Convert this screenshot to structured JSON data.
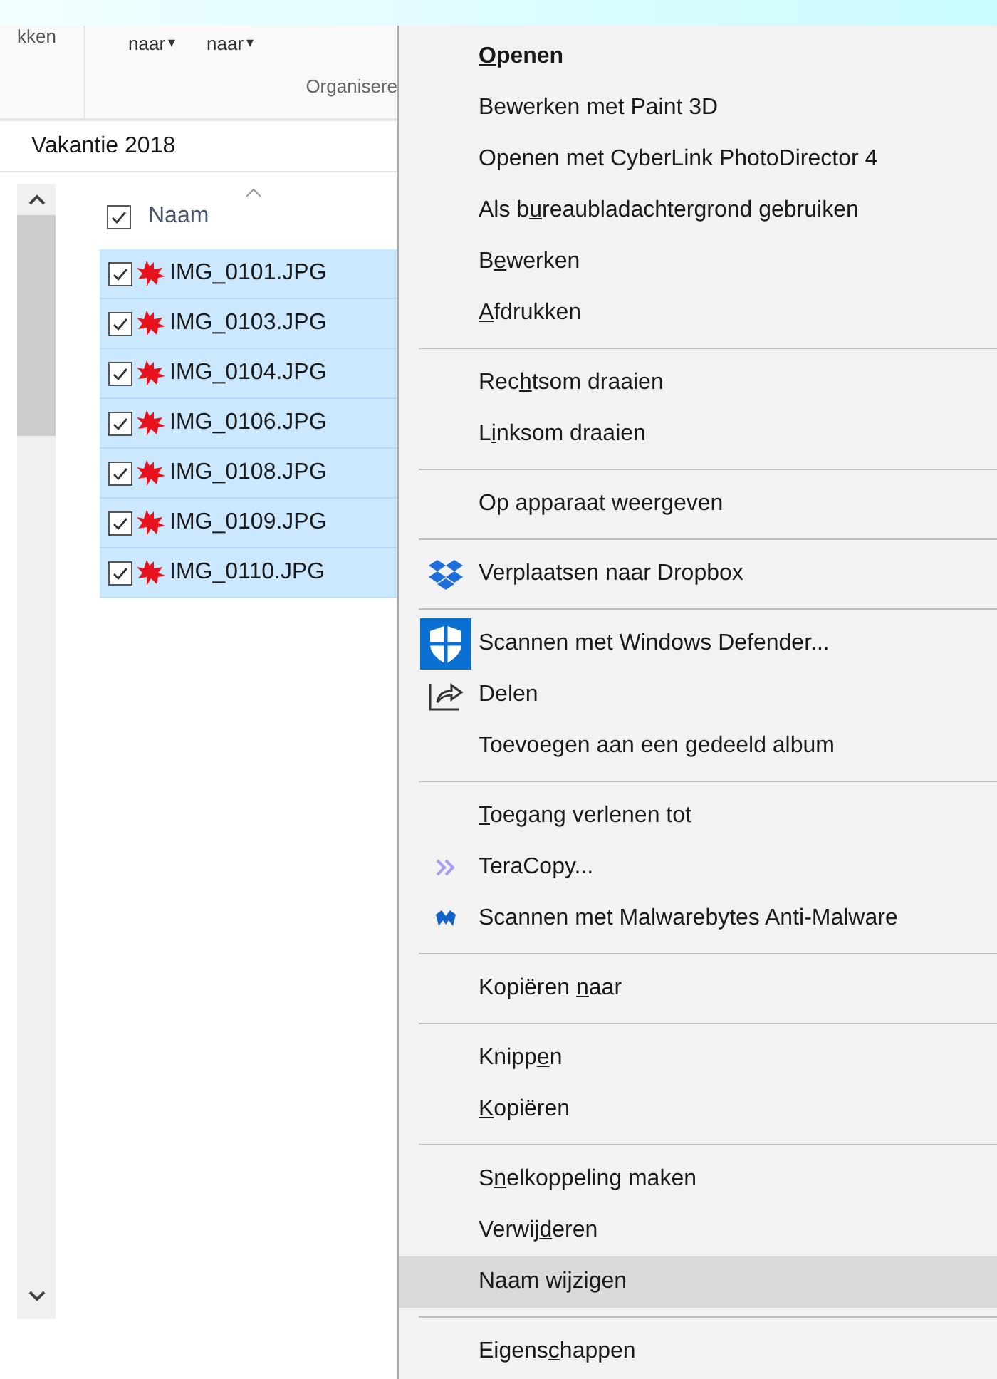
{
  "ribbon": {
    "cut_label": "kken",
    "buttons": [
      {
        "label": "naar",
        "caret": "▾"
      },
      {
        "label": "naar",
        "caret": "▾"
      }
    ],
    "group_label": "Organisere"
  },
  "address": "Vakantie 2018",
  "list_header": {
    "label": "Naam",
    "checked": true
  },
  "files": [
    {
      "name": "IMG_0101.JPG",
      "checked": true,
      "selected": true
    },
    {
      "name": "IMG_0103.JPG",
      "checked": true,
      "selected": true
    },
    {
      "name": "IMG_0104.JPG",
      "checked": true,
      "selected": true
    },
    {
      "name": "IMG_0106.JPG",
      "checked": true,
      "selected": true
    },
    {
      "name": "IMG_0108.JPG",
      "checked": true,
      "selected": true
    },
    {
      "name": "IMG_0109.JPG",
      "checked": true,
      "selected": true
    },
    {
      "name": "IMG_0110.JPG",
      "checked": true,
      "selected": true
    }
  ],
  "context_menu": [
    {
      "kind": "item",
      "key": "O",
      "post": "penen",
      "default": true,
      "selected": false
    },
    {
      "kind": "item",
      "pre": "Bewerken met Paint 3D",
      "default": false,
      "selected": false
    },
    {
      "kind": "item",
      "pre": "Openen met CyberLink PhotoDirector 4",
      "default": false,
      "selected": false
    },
    {
      "kind": "item",
      "pre": "Als b",
      "key": "u",
      "post": "reaubladachtergrond gebruiken",
      "default": false,
      "selected": false
    },
    {
      "kind": "item",
      "pre": "B",
      "key": "e",
      "post": "werken",
      "default": false,
      "selected": false
    },
    {
      "kind": "item",
      "key": "A",
      "post": "fdrukken",
      "default": false,
      "selected": false
    },
    {
      "kind": "separator"
    },
    {
      "kind": "item",
      "pre": "Rec",
      "key": "h",
      "post": "tsom draaien",
      "default": false,
      "selected": false
    },
    {
      "kind": "item",
      "pre": "L",
      "key": "i",
      "post": "nksom draaien",
      "default": false,
      "selected": false
    },
    {
      "kind": "separator"
    },
    {
      "kind": "item",
      "pre": "Op apparaat weergeven",
      "default": false,
      "selected": false
    },
    {
      "kind": "separator"
    },
    {
      "kind": "item",
      "pre": "Verplaatsen naar Dropbox",
      "default": false,
      "selected": false
    },
    {
      "kind": "separator"
    },
    {
      "kind": "item",
      "pre": "Scannen met Windows Defender...",
      "default": false,
      "selected": false
    },
    {
      "kind": "item",
      "pre": "Delen",
      "default": false,
      "selected": false
    },
    {
      "kind": "item",
      "pre": "Toevoegen aan een gedeeld album",
      "default": false,
      "selected": false
    },
    {
      "kind": "separator"
    },
    {
      "kind": "item",
      "key": "T",
      "post": "oegang verlenen tot",
      "default": false,
      "selected": false
    },
    {
      "kind": "item",
      "pre": "TeraCopy...",
      "default": false,
      "selected": false
    },
    {
      "kind": "item",
      "pre": "Scannen met Malwarebytes Anti-Malware",
      "default": false,
      "selected": false
    },
    {
      "kind": "separator"
    },
    {
      "kind": "item",
      "pre": "Kopiëren ",
      "key": "n",
      "post": "aar",
      "default": false,
      "selected": false
    },
    {
      "kind": "separator"
    },
    {
      "kind": "item",
      "pre": "Knipp",
      "key": "e",
      "post": "n",
      "default": false,
      "selected": false
    },
    {
      "kind": "item",
      "key": "K",
      "post": "opiëren",
      "default": false,
      "selected": false
    },
    {
      "kind": "separator"
    },
    {
      "kind": "item",
      "pre": "S",
      "key": "n",
      "post": "elkoppeling maken",
      "default": false,
      "selected": false
    },
    {
      "kind": "item",
      "pre": "Verwij",
      "key": "d",
      "post": "eren",
      "default": false,
      "selected": false
    },
    {
      "kind": "item",
      "pre": "Naam wijzigen",
      "default": false,
      "selected": true
    },
    {
      "kind": "separator"
    },
    {
      "kind": "item",
      "pre": "Eigens",
      "key": "c",
      "post": "happen",
      "default": false,
      "selected": false
    }
  ]
}
